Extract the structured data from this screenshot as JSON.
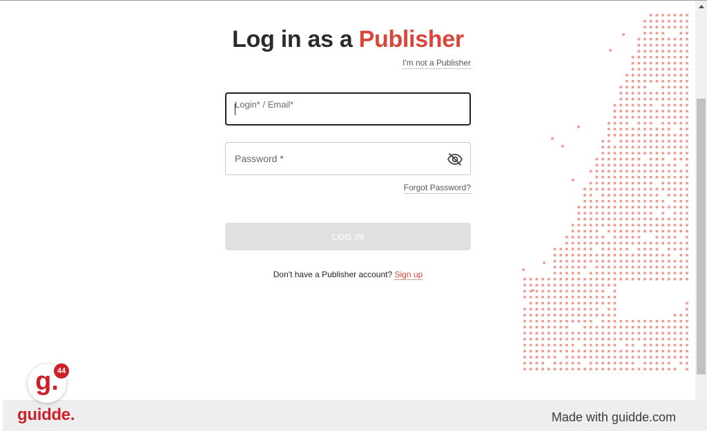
{
  "login": {
    "title_prefix": "Log in as a ",
    "title_accent": "Publisher",
    "not_publisher_link": "I'm not a Publisher",
    "email_label": "Login* / Email*",
    "email_value": "",
    "password_label": "Password *",
    "password_value": "",
    "forgot_password_link": "Forgot Password?",
    "login_button": "LOG IN",
    "signup_prompt": "Don't have a Publisher account?",
    "signup_link": "Sign up"
  },
  "footer": {
    "logo": "guidde.",
    "made_with": "Made with guidde.com",
    "avatar_letter": "g.",
    "badge_count": "44"
  },
  "icons": {
    "password_toggle": "eye-off-icon",
    "scroll_up": "chevron-up-icon"
  },
  "colors": {
    "accent": "#d8463a",
    "dots": "#ef9c93",
    "brand": "#cc2129",
    "button_disabled": "#e0e0e0"
  }
}
